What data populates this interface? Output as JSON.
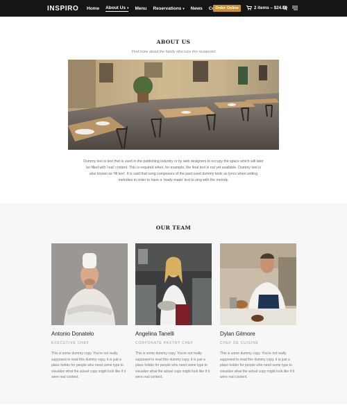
{
  "header": {
    "logo": "INSPIRO",
    "nav": [
      {
        "label": "Home",
        "caret": false,
        "active": false
      },
      {
        "label": "About Us",
        "caret": true,
        "active": true
      },
      {
        "label": "Menu",
        "caret": false,
        "active": false
      },
      {
        "label": "Reservations",
        "caret": true,
        "active": false
      },
      {
        "label": "News",
        "caret": false,
        "active": false
      },
      {
        "label": "Contact",
        "caret": false,
        "active": false
      }
    ],
    "order_button": "Order Online",
    "cart_text": "2 items – $24.50",
    "icons": {
      "cart": "cart-icon",
      "search": "search-icon",
      "menu": "hamburger-menu-icon"
    },
    "colors": {
      "bar": "#151515",
      "accent": "#c8912f"
    }
  },
  "about": {
    "title": "ABOUT US",
    "subtitle": "Find more about the family who runs this restaurant",
    "text": "Dummy text is text that is used in the publishing industry or by web designers to occupy the space which will later be filled with 'real' content. This is required when, for example, the final text is not yet available. Dummy text is also known as 'fill text'. It is said that song composers of the past used dummy texts as lyrics when writing melodies in order to have a 'ready-made' text to sing with the melody."
  },
  "team": {
    "title": "OUR TEAM",
    "members": [
      {
        "name": "Antonio Donatelo",
        "role": "EXECUTIVE CHEF",
        "bio": "This is some dummy copy. You're not really supposed to read this dummy copy, it is just a place holder for people who need some type to visualize what the actual copy might look like if it were real content."
      },
      {
        "name": "Angelina Tanelli",
        "role": "CORPORATE PASTRY CHEF",
        "bio": "This is some dummy copy. You're not really supposed to read this dummy copy, it is just a place holder for people who need some type to visualize what the actual copy might look like if it were real content."
      },
      {
        "name": "Dylan Gilmore",
        "role": "CHEF DE CUISINE",
        "bio": "This is some dummy copy. You're not really supposed to read this dummy copy, it is just a place holder for people who need some type to visualize what the actual copy might look like if it were real content."
      }
    ]
  }
}
